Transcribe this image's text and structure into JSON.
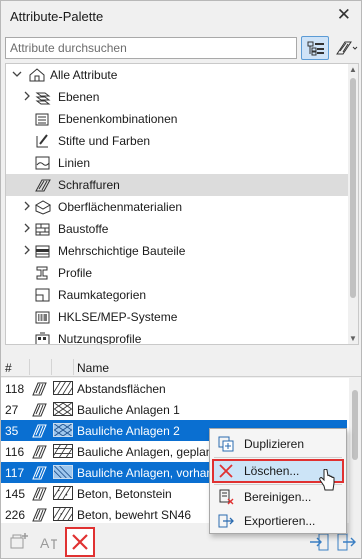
{
  "window": {
    "title": "Attribute-Palette"
  },
  "search": {
    "placeholder": "Attribute durchsuchen"
  },
  "tree": {
    "root": "Alle Attribute",
    "items": [
      {
        "label": "Ebenen",
        "expandable": true,
        "icon": "layers-icon"
      },
      {
        "label": "Ebenenkombinationen",
        "expandable": false,
        "icon": "layer-combinations-icon"
      },
      {
        "label": "Stifte und Farben",
        "expandable": false,
        "icon": "pens-colors-icon"
      },
      {
        "label": "Linien",
        "expandable": false,
        "icon": "line-types-icon"
      },
      {
        "label": "Schraffuren",
        "expandable": false,
        "icon": "fills-icon",
        "selected": true
      },
      {
        "label": "Oberflächenmaterialien",
        "expandable": true,
        "icon": "surfaces-icon"
      },
      {
        "label": "Baustoffe",
        "expandable": true,
        "icon": "building-materials-icon"
      },
      {
        "label": "Mehrschichtige Bauteile",
        "expandable": true,
        "icon": "composites-icon"
      },
      {
        "label": "Profile",
        "expandable": false,
        "icon": "profiles-icon"
      },
      {
        "label": "Raumkategorien",
        "expandable": false,
        "icon": "zone-categories-icon"
      },
      {
        "label": "HKLSE/MEP-Systeme",
        "expandable": false,
        "icon": "mep-systems-icon"
      },
      {
        "label": "Nutzungsprofile",
        "expandable": false,
        "icon": "operation-profiles-icon"
      }
    ]
  },
  "list": {
    "headers": {
      "num": "#",
      "name": "Name"
    },
    "rows": [
      {
        "num": "118",
        "name": "Abstandsflächen",
        "selected": false
      },
      {
        "num": "27",
        "name": "Bauliche Anlagen 1",
        "selected": false
      },
      {
        "num": "35",
        "name": "Bauliche Anlagen 2",
        "selected": true
      },
      {
        "num": "116",
        "name": "Bauliche Anlagen, geplant",
        "selected": false
      },
      {
        "num": "117",
        "name": "Bauliche Anlagen, vorhanden",
        "selected": true
      },
      {
        "num": "145",
        "name": "Beton, Betonstein",
        "selected": false
      },
      {
        "num": "226",
        "name": "Beton, bewehrt SN46",
        "selected": false
      }
    ]
  },
  "context_menu": {
    "items": [
      {
        "label": "Duplizieren",
        "icon": "duplicate-icon"
      },
      {
        "label": "Löschen...",
        "icon": "delete-x-icon",
        "highlighted": true
      },
      {
        "label": "Bereinigen...",
        "icon": "purge-icon"
      },
      {
        "label": "Exportieren...",
        "icon": "export-icon"
      }
    ]
  },
  "colors": {
    "selection": "#0a6fd1",
    "highlight_border": "#e03131",
    "delete_red": "#e03131"
  }
}
